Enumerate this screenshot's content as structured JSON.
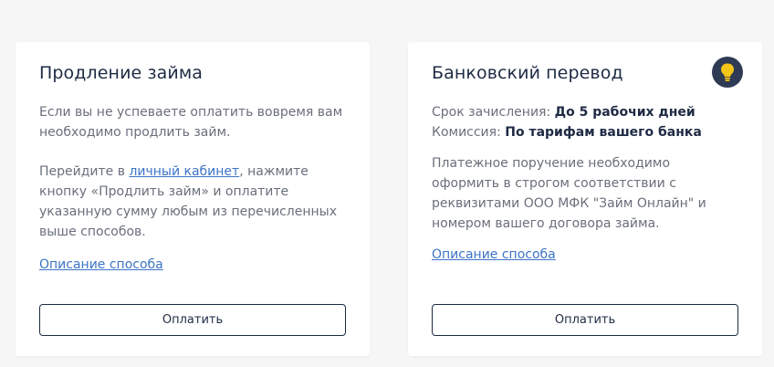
{
  "cards": [
    {
      "title": "Продление займа",
      "intro_lines": [
        "Если вы не успеваете оплатить вовремя вам",
        "необходимо продлить займ."
      ],
      "instr_prefix": "Перейдите в ",
      "instr_link": "личный кабинет",
      "instr_suffix": ", нажмите",
      "instr_lines": [
        "кнопку «Продлить займ» и оплатите",
        "указанную сумму любым из перечисленных",
        "выше способов."
      ],
      "method_link": "Описание способа",
      "button": "Оплатить"
    },
    {
      "title": "Банковский перевод",
      "hint_icon": "lightbulb-icon",
      "term_label": "Срок зачисления: ",
      "term_value": "До 5 рабочих дней",
      "fee_label": "Комиссия: ",
      "fee_value": "По тарифам вашего банка",
      "desc_lines": [
        "Платежное поручение необходимо",
        "оформить в строгом соответствии с",
        "реквизитами ООО МФК \"Займ Онлайн\" и",
        "номером вашего договора займа."
      ],
      "method_link": "Описание способа",
      "button": "Оплатить"
    }
  ],
  "colors": {
    "page_bg": "#f6f6f7",
    "card_bg": "#ffffff",
    "heading": "#1e2a44",
    "body_text": "#6a6f7b",
    "link": "#3c74c7",
    "icon_bg": "#2f3b55",
    "icon_fg": "#f5c518"
  }
}
